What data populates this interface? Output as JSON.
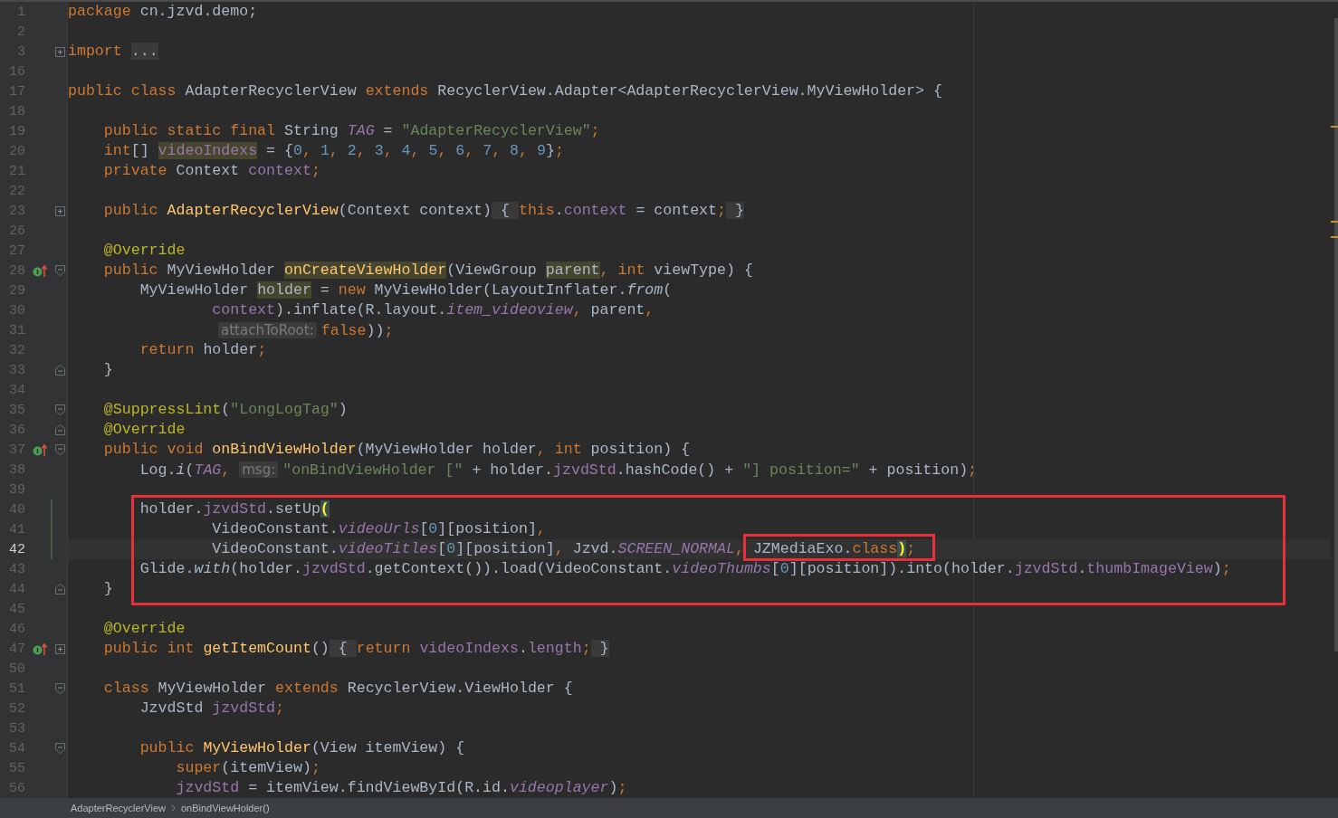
{
  "editor": {
    "lines": [
      {
        "number": "1",
        "current": false,
        "tokens": [
          {
            "kind": "keyword",
            "text": "package "
          },
          {
            "kind": "plain",
            "text": "cn.jzvd.demo;"
          }
        ]
      },
      {
        "number": "2",
        "current": false
      },
      {
        "number": "3",
        "current": false,
        "fold": {
          "kind": "expand"
        },
        "tokens": [
          {
            "kind": "keyword",
            "text": "import "
          },
          {
            "kind": "folded",
            "text": "..."
          }
        ]
      },
      {
        "number": "16",
        "current": false
      },
      {
        "number": "17",
        "current": false,
        "tokens": [
          {
            "kind": "keyword",
            "text": "public class "
          },
          {
            "kind": "plain",
            "text": "AdapterRecyclerView "
          },
          {
            "kind": "keyword",
            "text": "extends "
          },
          {
            "kind": "plain",
            "text": "RecyclerView.Adapter<AdapterRecyclerView.MyViewHolder> {"
          }
        ]
      },
      {
        "number": "18",
        "current": false
      },
      {
        "number": "19",
        "current": false,
        "tokens": [
          {
            "kind": "keyword",
            "text": "    public static final "
          },
          {
            "kind": "plain",
            "text": "String "
          },
          {
            "kind": "constant",
            "text": "TAG"
          },
          {
            "kind": "plain",
            "text": " = "
          },
          {
            "kind": "string",
            "text": "\"AdapterRecyclerView\""
          },
          {
            "kind": "keyword",
            "text": ";"
          }
        ]
      },
      {
        "number": "20",
        "current": false,
        "tokens": [
          {
            "kind": "keyword",
            "text": "    int"
          },
          {
            "kind": "plain",
            "text": "[] "
          },
          {
            "kind": "markedfield",
            "text": "videoIndexs"
          },
          {
            "kind": "plain",
            "text": " = {"
          },
          {
            "kind": "number",
            "text": "0"
          },
          {
            "kind": "keyword",
            "text": ", "
          },
          {
            "kind": "number",
            "text": "1"
          },
          {
            "kind": "keyword",
            "text": ", "
          },
          {
            "kind": "number",
            "text": "2"
          },
          {
            "kind": "keyword",
            "text": ", "
          },
          {
            "kind": "number",
            "text": "3"
          },
          {
            "kind": "keyword",
            "text": ", "
          },
          {
            "kind": "number",
            "text": "4"
          },
          {
            "kind": "keyword",
            "text": ", "
          },
          {
            "kind": "number",
            "text": "5"
          },
          {
            "kind": "keyword",
            "text": ", "
          },
          {
            "kind": "number",
            "text": "6"
          },
          {
            "kind": "keyword",
            "text": ", "
          },
          {
            "kind": "number",
            "text": "7"
          },
          {
            "kind": "keyword",
            "text": ", "
          },
          {
            "kind": "number",
            "text": "8"
          },
          {
            "kind": "keyword",
            "text": ", "
          },
          {
            "kind": "number",
            "text": "9"
          },
          {
            "kind": "plain",
            "text": "}"
          },
          {
            "kind": "keyword",
            "text": ";"
          }
        ]
      },
      {
        "number": "21",
        "current": false,
        "tokens": [
          {
            "kind": "keyword",
            "text": "    private "
          },
          {
            "kind": "plain",
            "text": "Context "
          },
          {
            "kind": "field",
            "text": "context"
          },
          {
            "kind": "keyword",
            "text": ";"
          }
        ]
      },
      {
        "number": "22",
        "current": false
      },
      {
        "number": "23",
        "current": false,
        "fold": {
          "kind": "expand"
        },
        "tokens": [
          {
            "kind": "keyword",
            "text": "    public "
          },
          {
            "kind": "declaration",
            "text": "AdapterRecyclerView"
          },
          {
            "kind": "plain",
            "text": "(Context context)"
          },
          {
            "kind": "folded",
            "text": " { "
          },
          {
            "kind": "keyword",
            "text": "this"
          },
          {
            "kind": "plain",
            "text": "."
          },
          {
            "kind": "field",
            "text": "context"
          },
          {
            "kind": "plain",
            "text": " = context"
          },
          {
            "kind": "keyword",
            "text": ";"
          },
          {
            "kind": "folded",
            "text": " }"
          }
        ]
      },
      {
        "number": "26",
        "current": false
      },
      {
        "number": "27",
        "current": false,
        "tokens": [
          {
            "kind": "annotation",
            "text": "    @Override"
          }
        ]
      },
      {
        "number": "28",
        "current": false,
        "marker": {
          "kind": "override"
        },
        "fold": {
          "kind": "start"
        },
        "tokens": [
          {
            "kind": "keyword",
            "text": "    public "
          },
          {
            "kind": "plain",
            "text": "MyViewHolder "
          },
          {
            "kind": "markeddecl",
            "text": "onCreateViewHolder"
          },
          {
            "kind": "plain",
            "text": "(ViewGroup "
          },
          {
            "kind": "markedplain",
            "text": "parent"
          },
          {
            "kind": "keyword",
            "text": ", int "
          },
          {
            "kind": "plain",
            "text": "viewType) {"
          }
        ]
      },
      {
        "number": "29",
        "current": false,
        "tokens": [
          {
            "kind": "plain",
            "text": "        MyViewHolder "
          },
          {
            "kind": "markedplain",
            "text": "holder"
          },
          {
            "kind": "plain",
            "text": " = "
          },
          {
            "kind": "keyword",
            "text": "new "
          },
          {
            "kind": "plain",
            "text": "MyViewHolder(LayoutInflater."
          },
          {
            "kind": "italic",
            "text": "from"
          },
          {
            "kind": "plain",
            "text": "("
          }
        ]
      },
      {
        "number": "30",
        "current": false,
        "tokens": [
          {
            "kind": "field",
            "text": "                context"
          },
          {
            "kind": "plain",
            "text": ").inflate(R.layout."
          },
          {
            "kind": "constant",
            "text": "item_videoview"
          },
          {
            "kind": "keyword",
            "text": ", "
          },
          {
            "kind": "plain",
            "text": "parent"
          },
          {
            "kind": "keyword",
            "text": ","
          }
        ]
      },
      {
        "number": "31",
        "current": false,
        "tokens": [
          {
            "kind": "hint",
            "text": "attachToRoot:"
          },
          {
            "kind": "keyword",
            "text": "false"
          },
          {
            "kind": "plain",
            "text": "))"
          },
          {
            "kind": "keyword",
            "text": ";"
          }
        ]
      },
      {
        "number": "32",
        "current": false,
        "tokens": [
          {
            "kind": "keyword",
            "text": "        return "
          },
          {
            "kind": "plain",
            "text": "holder"
          },
          {
            "kind": "keyword",
            "text": ";"
          }
        ]
      },
      {
        "number": "33",
        "current": false,
        "fold": {
          "kind": "end"
        },
        "tokens": [
          {
            "kind": "plain",
            "text": "    }"
          }
        ]
      },
      {
        "number": "34",
        "current": false
      },
      {
        "number": "35",
        "current": false,
        "fold": {
          "kind": "start"
        },
        "tokens": [
          {
            "kind": "annotation",
            "text": "    @SuppressLint"
          },
          {
            "kind": "plain",
            "text": "("
          },
          {
            "kind": "string",
            "text": "\"LongLogTag\""
          },
          {
            "kind": "plain",
            "text": ")"
          }
        ]
      },
      {
        "number": "36",
        "current": false,
        "fold": {
          "kind": "end"
        },
        "tokens": [
          {
            "kind": "annotation",
            "text": "    @Override"
          }
        ]
      },
      {
        "number": "37",
        "current": false,
        "marker": {
          "kind": "override"
        },
        "fold": {
          "kind": "start"
        },
        "tokens": [
          {
            "kind": "keyword",
            "text": "    public void "
          },
          {
            "kind": "declaration",
            "text": "onBindViewHolder"
          },
          {
            "kind": "plain",
            "text": "(MyViewHolder holder"
          },
          {
            "kind": "keyword",
            "text": ", int "
          },
          {
            "kind": "plain",
            "text": "position) {"
          }
        ]
      },
      {
        "number": "38",
        "current": false,
        "tokens": [
          {
            "kind": "plain",
            "text": "        Log."
          },
          {
            "kind": "italic",
            "text": "i"
          },
          {
            "kind": "plain",
            "text": "("
          },
          {
            "kind": "constant",
            "text": "TAG"
          },
          {
            "kind": "keyword",
            "text": ", "
          },
          {
            "kind": "hint",
            "text": "msg:"
          },
          {
            "kind": "string",
            "text": "\"onBindViewHolder [\""
          },
          {
            "kind": "plain",
            "text": " + holder."
          },
          {
            "kind": "field",
            "text": "jzvdStd"
          },
          {
            "kind": "plain",
            "text": ".hashCode() + "
          },
          {
            "kind": "string",
            "text": "\"] position=\""
          },
          {
            "kind": "plain",
            "text": " + position)"
          },
          {
            "kind": "keyword",
            "text": ";"
          }
        ]
      },
      {
        "number": "39",
        "current": false
      },
      {
        "number": "40",
        "current": false,
        "change": {
          "kind": "modified"
        },
        "tokens": [
          {
            "kind": "plain",
            "text": "        holder."
          },
          {
            "kind": "field",
            "text": "jzvdStd"
          },
          {
            "kind": "plain",
            "text": ".setUp"
          },
          {
            "kind": "brace",
            "text": "("
          }
        ]
      },
      {
        "number": "41",
        "current": false,
        "change": {
          "kind": "modified"
        },
        "tokens": [
          {
            "kind": "plain",
            "text": "                VideoConstant."
          },
          {
            "kind": "constant",
            "text": "videoUrls"
          },
          {
            "kind": "plain",
            "text": "["
          },
          {
            "kind": "number",
            "text": "0"
          },
          {
            "kind": "plain",
            "text": "][position]"
          },
          {
            "kind": "keyword",
            "text": ","
          }
        ]
      },
      {
        "number": "42",
        "current": true,
        "change": {
          "kind": "modified"
        },
        "tokens": [
          {
            "kind": "plain",
            "text": "                VideoConstant."
          },
          {
            "kind": "constant",
            "text": "videoTitles"
          },
          {
            "kind": "plain",
            "text": "["
          },
          {
            "kind": "number",
            "text": "0"
          },
          {
            "kind": "plain",
            "text": "][position]"
          },
          {
            "kind": "keyword",
            "text": ", "
          },
          {
            "kind": "plain",
            "text": "Jzvd."
          },
          {
            "kind": "constant",
            "text": "SCREEN_NORMAL"
          },
          {
            "kind": "keyword",
            "text": ", "
          },
          {
            "kind": "plain",
            "text": "JZMediaExo."
          },
          {
            "kind": "keyword",
            "text": "class"
          },
          {
            "kind": "brace",
            "text": ")"
          },
          {
            "kind": "keyword",
            "text": ";"
          }
        ]
      },
      {
        "number": "43",
        "current": false,
        "tokens": [
          {
            "kind": "plain",
            "text": "        Glide."
          },
          {
            "kind": "italic",
            "text": "with"
          },
          {
            "kind": "plain",
            "text": "(holder."
          },
          {
            "kind": "field",
            "text": "jzvdStd"
          },
          {
            "kind": "plain",
            "text": ".getContext()).load(VideoConstant."
          },
          {
            "kind": "constant",
            "text": "videoThumbs"
          },
          {
            "kind": "plain",
            "text": "["
          },
          {
            "kind": "number",
            "text": "0"
          },
          {
            "kind": "plain",
            "text": "][position]).into(holder."
          },
          {
            "kind": "field",
            "text": "jzvdStd"
          },
          {
            "kind": "plain",
            "text": "."
          },
          {
            "kind": "field",
            "text": "thumbImageView"
          },
          {
            "kind": "plain",
            "text": ")"
          },
          {
            "kind": "keyword",
            "text": ";"
          }
        ]
      },
      {
        "number": "44",
        "current": false,
        "fold": {
          "kind": "end"
        },
        "tokens": [
          {
            "kind": "plain",
            "text": "    }"
          }
        ]
      },
      {
        "number": "45",
        "current": false
      },
      {
        "number": "46",
        "current": false,
        "tokens": [
          {
            "kind": "annotation",
            "text": "    @Override"
          }
        ]
      },
      {
        "number": "47",
        "current": false,
        "marker": {
          "kind": "override"
        },
        "fold": {
          "kind": "expand"
        },
        "tokens": [
          {
            "kind": "keyword",
            "text": "    public int "
          },
          {
            "kind": "declaration",
            "text": "getItemCount"
          },
          {
            "kind": "plain",
            "text": "()"
          },
          {
            "kind": "folded",
            "text": " { "
          },
          {
            "kind": "keyword",
            "text": "return "
          },
          {
            "kind": "field",
            "text": "videoIndexs"
          },
          {
            "kind": "plain",
            "text": "."
          },
          {
            "kind": "field",
            "text": "length"
          },
          {
            "kind": "keyword",
            "text": ";"
          },
          {
            "kind": "folded",
            "text": " }"
          }
        ]
      },
      {
        "number": "50",
        "current": false
      },
      {
        "number": "51",
        "current": false,
        "fold": {
          "kind": "start"
        },
        "tokens": [
          {
            "kind": "keyword",
            "text": "    class "
          },
          {
            "kind": "plain",
            "text": "MyViewHolder "
          },
          {
            "kind": "keyword",
            "text": "extends "
          },
          {
            "kind": "plain",
            "text": "RecyclerView.ViewHolder {"
          }
        ]
      },
      {
        "number": "52",
        "current": false,
        "tokens": [
          {
            "kind": "plain",
            "text": "        JzvdStd "
          },
          {
            "kind": "field",
            "text": "jzvdStd"
          },
          {
            "kind": "keyword",
            "text": ";"
          }
        ]
      },
      {
        "number": "53",
        "current": false
      },
      {
        "number": "54",
        "current": false,
        "fold": {
          "kind": "start"
        },
        "tokens": [
          {
            "kind": "keyword",
            "text": "        public "
          },
          {
            "kind": "declaration",
            "text": "MyViewHolder"
          },
          {
            "kind": "plain",
            "text": "(View itemView) {"
          }
        ]
      },
      {
        "number": "55",
        "current": false,
        "tokens": [
          {
            "kind": "keyword",
            "text": "            super"
          },
          {
            "kind": "plain",
            "text": "(itemView)"
          },
          {
            "kind": "keyword",
            "text": ";"
          }
        ]
      },
      {
        "number": "56",
        "current": false,
        "tokens": [
          {
            "kind": "field",
            "text": "            jzvdStd"
          },
          {
            "kind": "plain",
            "text": " = itemView.findViewById(R.id."
          },
          {
            "kind": "constant",
            "text": "videoplayer"
          },
          {
            "kind": "plain",
            "text": ")"
          },
          {
            "kind": "keyword",
            "text": ";"
          }
        ]
      }
    ]
  },
  "breadcrumbs": [
    "AdapterRecyclerView",
    "onBindViewHolder()"
  ]
}
